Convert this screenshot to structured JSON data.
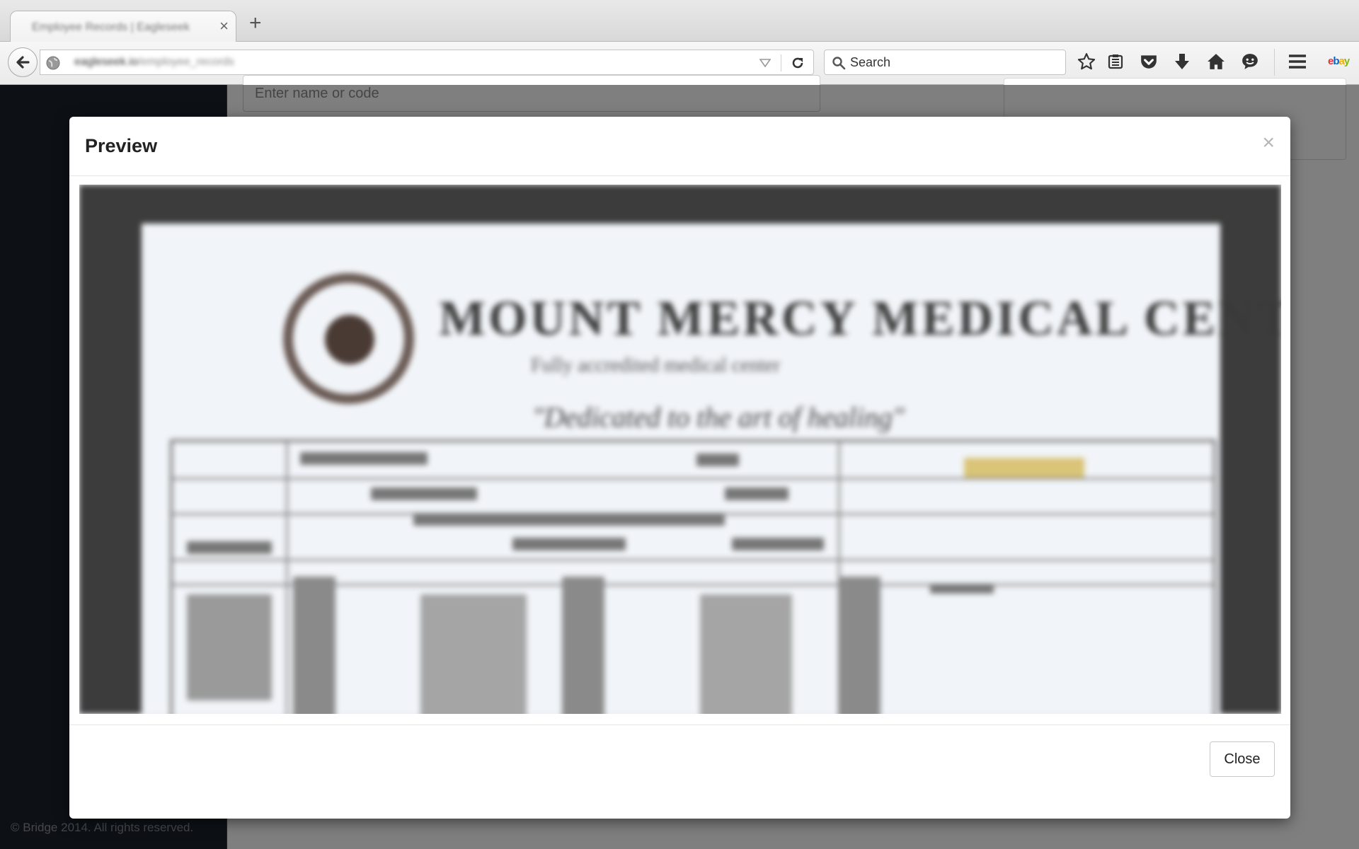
{
  "browser": {
    "tab_title": "Employee Records | Eagleseek",
    "url_host": "eagleseek.io",
    "url_path": "/employee_records",
    "search_placeholder": "Search"
  },
  "page": {
    "search_placeholder": "Enter name or code",
    "footer": "© Bridge 2014. All rights reserved."
  },
  "modal": {
    "title": "Preview",
    "close_symbol": "×",
    "close_button": "Close"
  },
  "preview_doc": {
    "heading": "MOUNT MERCY MEDICAL CENTER",
    "subheading": "Fully accredited medical center",
    "motto": "\"Dedicated to the art of healing\""
  },
  "icons": [
    "back-arrow-icon",
    "globe-icon",
    "dropdown-icon",
    "reload-icon",
    "search-icon",
    "bookmark-star-icon",
    "reading-list-icon",
    "pocket-icon",
    "download-icon",
    "home-icon",
    "chat-icon",
    "menu-icon"
  ],
  "colors": {
    "sidebar": "#1b222d",
    "overlay": "rgba(0,0,0,0.5)",
    "ebay_e": "#e53238",
    "ebay_b": "#0064d2",
    "ebay_a": "#f5af02",
    "ebay_y": "#86b817"
  }
}
